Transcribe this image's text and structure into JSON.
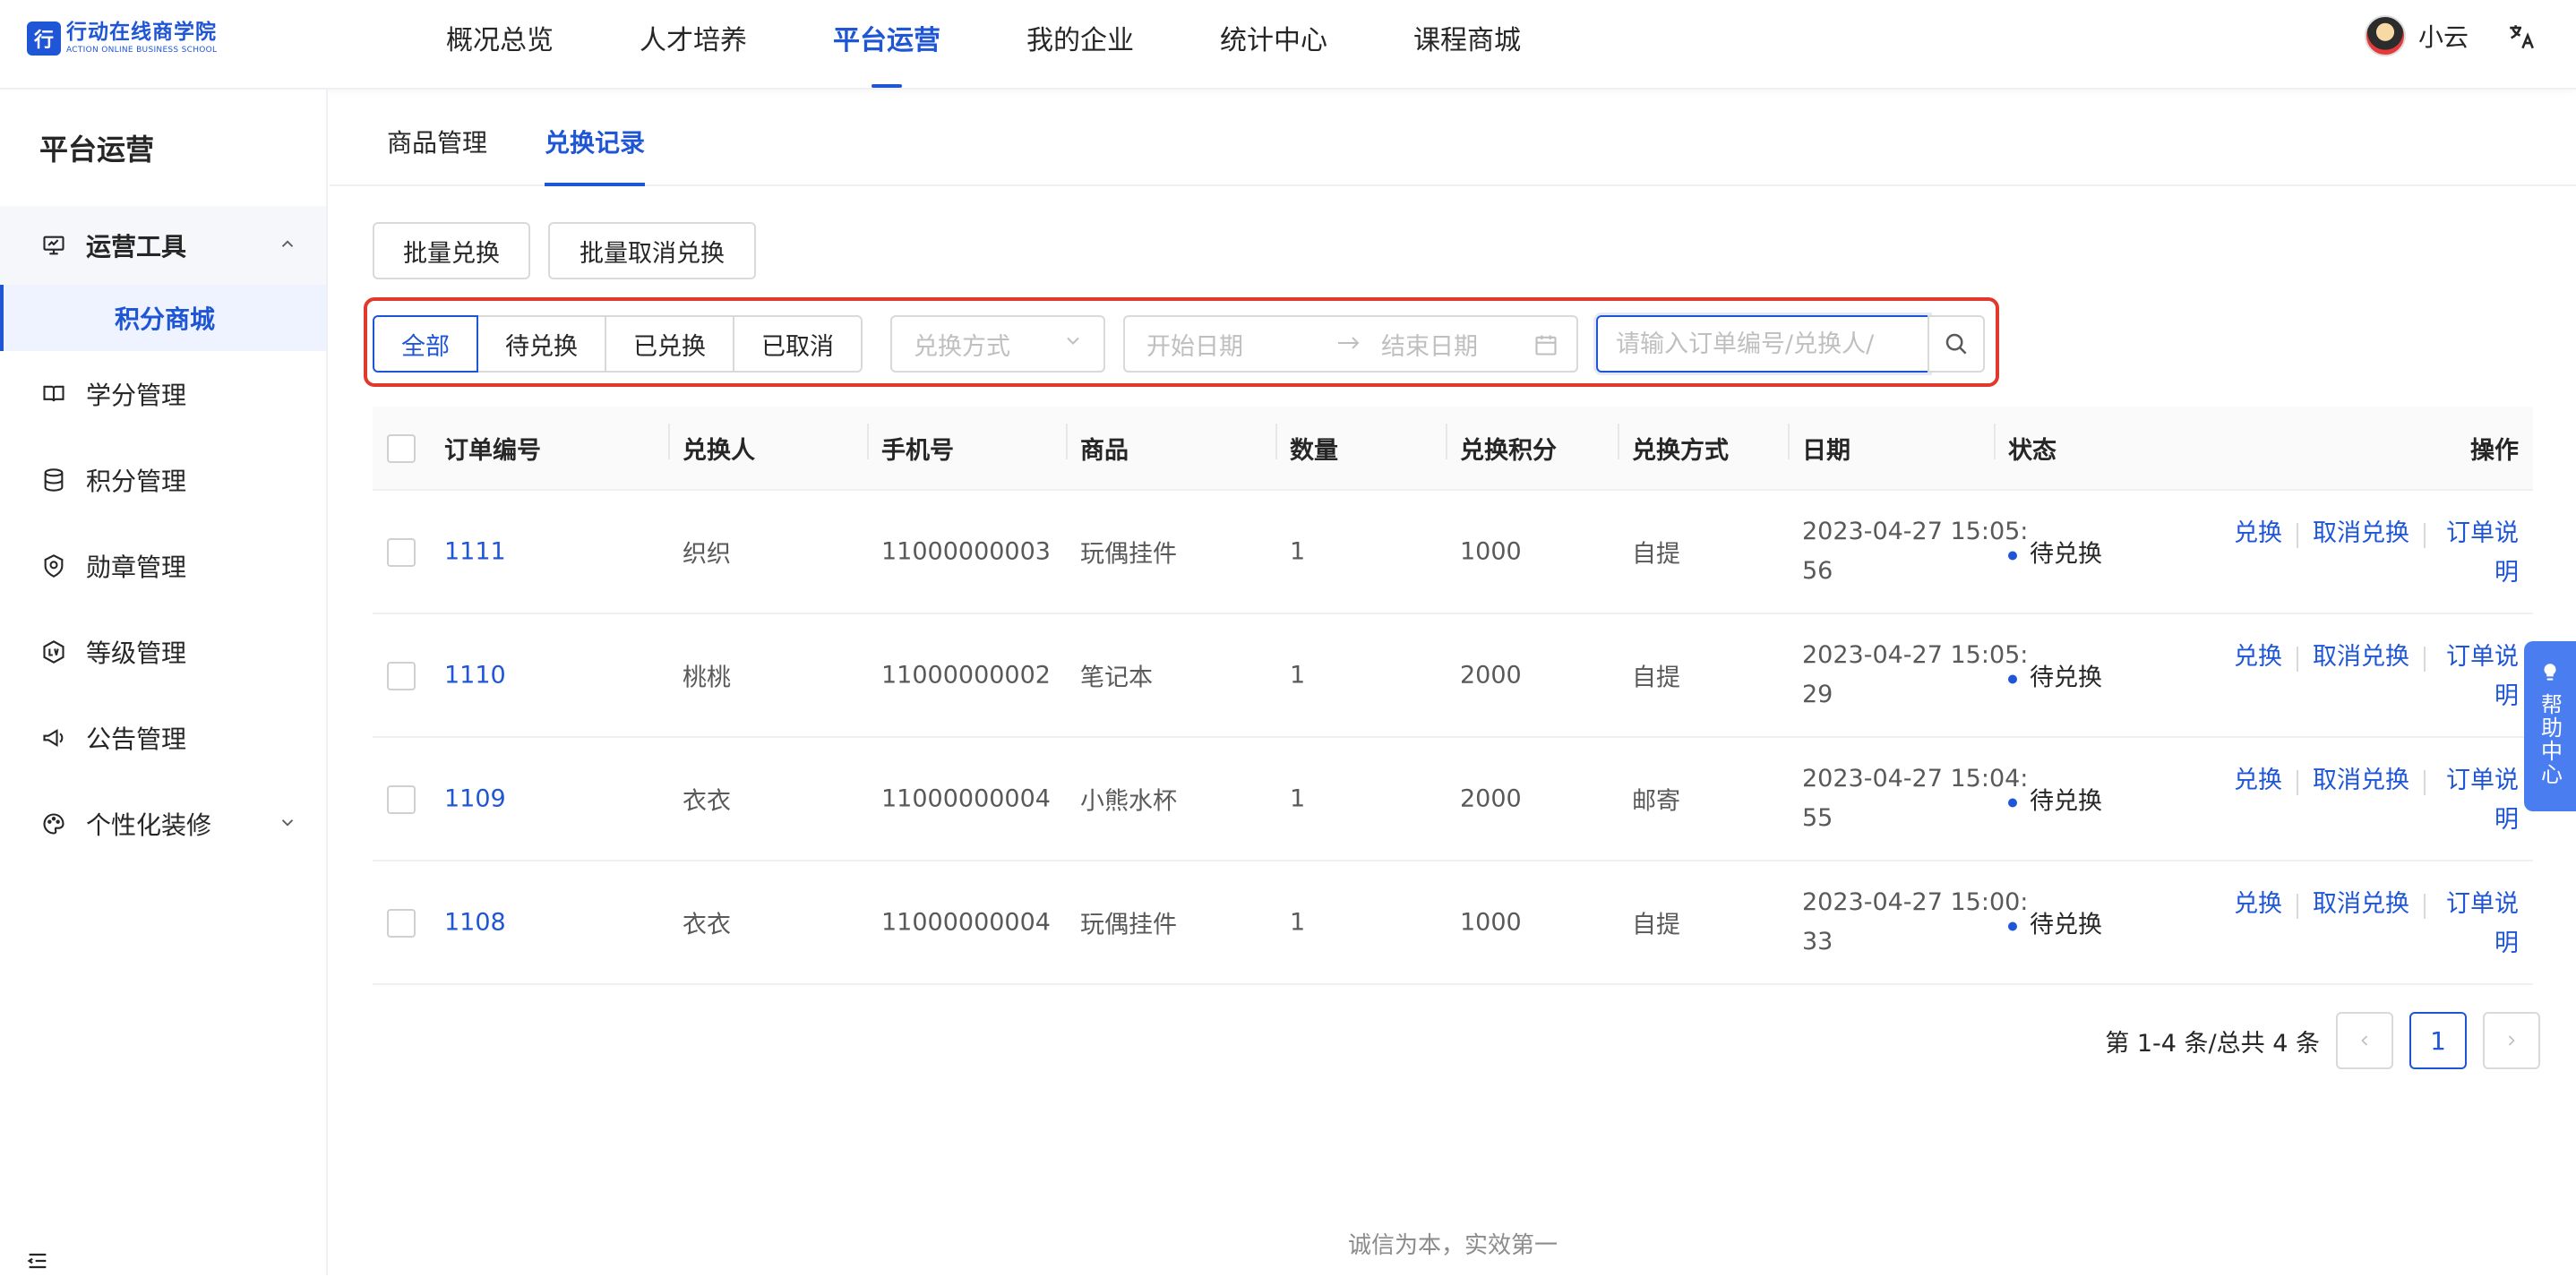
{
  "logo": {
    "cn": "行动在线商学院",
    "en": "ACTION ONLINE BUSINESS SCHOOL",
    "mark": "行"
  },
  "nav": [
    "概况总览",
    "人才培养",
    "平台运营",
    "我的企业",
    "统计中心",
    "课程商城"
  ],
  "nav_active": "平台运营",
  "user": {
    "name": "小云"
  },
  "lang_icon": "translate-icon",
  "sidebar": {
    "title": "平台运营",
    "group": "运营工具",
    "sub_active": "积分商城",
    "items": [
      "学分管理",
      "积分管理",
      "勋章管理",
      "等级管理",
      "公告管理",
      "个性化装修"
    ]
  },
  "tabs": [
    "商品管理",
    "兑换记录"
  ],
  "tab_active": "兑换记录",
  "actions": {
    "batch_exchange": "批量兑换",
    "batch_cancel": "批量取消兑换"
  },
  "filters": {
    "status": [
      "全部",
      "待兑换",
      "已兑换",
      "已取消"
    ],
    "status_active": "全部",
    "method_placeholder": "兑换方式",
    "start_placeholder": "开始日期",
    "end_placeholder": "结束日期",
    "search_placeholder": "请输入订单编号/兑换人/"
  },
  "table": {
    "columns": [
      "订单编号",
      "兑换人",
      "手机号",
      "商品",
      "数量",
      "兑换积分",
      "兑换方式",
      "日期",
      "状态",
      "操作"
    ],
    "rows": [
      {
        "id": "1111",
        "name": "织织",
        "phone": "11000000003",
        "product": "玩偶挂件",
        "qty": "1",
        "points": "1000",
        "method": "自提",
        "date1": "2023-04-27 15:05:",
        "date2": "56",
        "status": "待兑换"
      },
      {
        "id": "1110",
        "name": "桃桃",
        "phone": "11000000002",
        "product": "笔记本",
        "qty": "1",
        "points": "2000",
        "method": "自提",
        "date1": "2023-04-27 15:05:",
        "date2": "29",
        "status": "待兑换"
      },
      {
        "id": "1109",
        "name": "衣衣",
        "phone": "11000000004",
        "product": "小熊水杯",
        "qty": "1",
        "points": "2000",
        "method": "邮寄",
        "date1": "2023-04-27 15:04:",
        "date2": "55",
        "status": "待兑换"
      },
      {
        "id": "1108",
        "name": "衣衣",
        "phone": "11000000004",
        "product": "玩偶挂件",
        "qty": "1",
        "points": "1000",
        "method": "自提",
        "date1": "2023-04-27 15:00:",
        "date2": "33",
        "status": "待兑换"
      }
    ],
    "ops": {
      "exchange": "兑换",
      "cancel": "取消兑换",
      "note1": "订单说",
      "note2": "明"
    }
  },
  "pager": {
    "total": "第 1-4 条/总共 4 条",
    "page": "1",
    "prev": "‹",
    "next": "›"
  },
  "footer": "诚信为本，实效第一",
  "help": {
    "label": "帮助中心"
  },
  "colors": {
    "accent": "#1f56d6",
    "highlight": "#e1392b",
    "help": "#4a7ef0"
  }
}
